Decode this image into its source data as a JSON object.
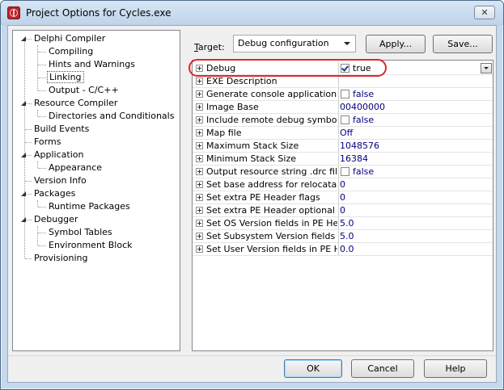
{
  "window": {
    "title": "Project Options for Cycles.exe",
    "close_glyph": "✕"
  },
  "tree": {
    "items": [
      {
        "label": "Delphi Compiler",
        "level": 0,
        "expanded": true
      },
      {
        "label": "Compiling",
        "level": 1
      },
      {
        "label": "Hints and Warnings",
        "level": 1
      },
      {
        "label": "Linking",
        "level": 1,
        "selected": true
      },
      {
        "label": "Output - C/C++",
        "level": 1
      },
      {
        "label": "Resource Compiler",
        "level": 0,
        "expanded": true
      },
      {
        "label": "Directories and Conditionals",
        "level": 1
      },
      {
        "label": "Build Events",
        "level": 0
      },
      {
        "label": "Forms",
        "level": 0
      },
      {
        "label": "Application",
        "level": 0,
        "expanded": true
      },
      {
        "label": "Appearance",
        "level": 1
      },
      {
        "label": "Version Info",
        "level": 0
      },
      {
        "label": "Packages",
        "level": 0,
        "expanded": true
      },
      {
        "label": "Runtime Packages",
        "level": 1
      },
      {
        "label": "Debugger",
        "level": 0,
        "expanded": true
      },
      {
        "label": "Symbol Tables",
        "level": 1
      },
      {
        "label": "Environment Block",
        "level": 1
      },
      {
        "label": "Provisioning",
        "level": 0
      }
    ]
  },
  "target": {
    "label_accel": "T",
    "label_rest": "arget:",
    "selected": "Debug configuration",
    "apply_label": "Apply...",
    "save_label": "Save..."
  },
  "grid": {
    "rows": [
      {
        "name": "Debug",
        "value": "true",
        "checkbox": true,
        "checked": true,
        "dropdown": true
      },
      {
        "name": "EXE Description",
        "value": ""
      },
      {
        "name": "Generate console application",
        "value": "false",
        "checkbox": true,
        "checked": false
      },
      {
        "name": "Image Base",
        "value": "00400000"
      },
      {
        "name": "Include remote debug symbols",
        "value": "false",
        "checkbox": true,
        "checked": false
      },
      {
        "name": "Map file",
        "value": "Off"
      },
      {
        "name": "Maximum Stack Size",
        "value": "1048576"
      },
      {
        "name": "Minimum Stack Size",
        "value": "16384"
      },
      {
        "name": "Output resource string .drc file",
        "value": "false",
        "checkbox": true,
        "checked": false
      },
      {
        "name": "Set base address for relocatable i",
        "value": "0"
      },
      {
        "name": "Set extra PE Header flags",
        "value": "0"
      },
      {
        "name": "Set extra PE Header optional flag:",
        "value": "0"
      },
      {
        "name": "Set OS Version fields in PE Header",
        "value": "5.0"
      },
      {
        "name": "Set Subsystem Version fields in PE",
        "value": "5.0"
      },
      {
        "name": "Set User Version fields in PE Head",
        "value": "0.0"
      }
    ]
  },
  "buttons": {
    "ok": "OK",
    "cancel": "Cancel",
    "help": "Help"
  },
  "colors": {
    "value_text": "#00007f",
    "highlight_ring": "#e0262b"
  }
}
